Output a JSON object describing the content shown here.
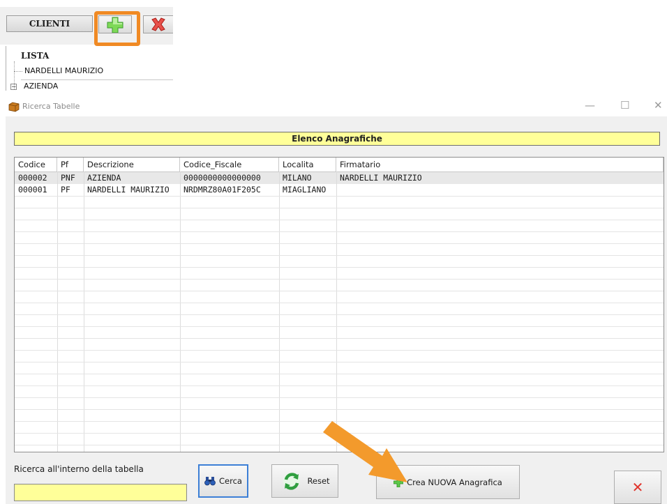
{
  "tree": {
    "tab_label": "CLIENTI",
    "root_label": "LISTA",
    "items": [
      "NARDELLI MAURIZIO",
      "AZIENDA"
    ],
    "expand_symbol": "−"
  },
  "window": {
    "title": "Ricerca Tabelle",
    "controls": {
      "minimize": "—",
      "maximize": "☐",
      "close": "✕"
    }
  },
  "header": {
    "title": "Elenco Anagrafiche"
  },
  "table": {
    "columns": [
      "Codice",
      "Pf",
      "Descrizione",
      "Codice_Fiscale",
      "Localita",
      "Firmatario"
    ],
    "rows": [
      [
        "000002",
        "PNF",
        "AZIENDA",
        "0000000000000000",
        "MILANO",
        "NARDELLI MAURIZIO"
      ],
      [
        "000001",
        "PF",
        "NARDELLI MAURIZIO",
        "NRDMRZ80A01F205C",
        "MIAGLIANO",
        ""
      ]
    ]
  },
  "search": {
    "label": "Ricerca all'interno della tabella",
    "value": ""
  },
  "buttons": {
    "cerca": "Cerca",
    "reset": "Reset",
    "crea": "Crea NUOVA Anagrafica",
    "close": "✕"
  },
  "colors": {
    "header_bg": "#ffff99",
    "input_bg": "#ffff99",
    "highlight": "#f08a24",
    "add_icon": "#3cb043",
    "delete_icon": "#d93025",
    "focus_border": "#3c7fd6"
  }
}
